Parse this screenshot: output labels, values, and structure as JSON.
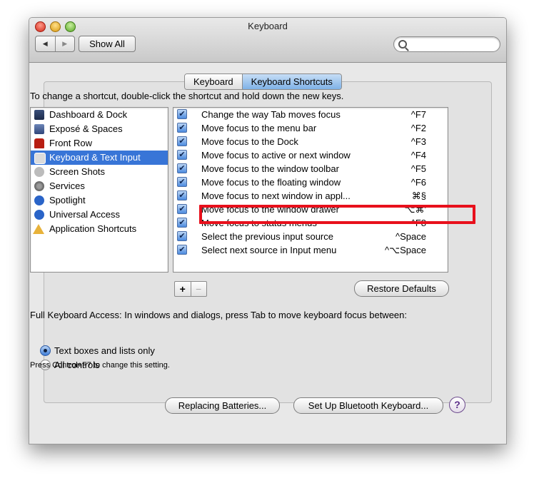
{
  "window": {
    "title": "Keyboard",
    "show_all_label": "Show All",
    "search_placeholder": ""
  },
  "tabs": [
    {
      "label": "Keyboard",
      "active": false
    },
    {
      "label": "Keyboard Shortcuts",
      "active": true
    }
  ],
  "instructions": "To change a shortcut, double-click the shortcut and hold down the new keys.",
  "sidebar": {
    "items": [
      {
        "label": "Dashboard & Dock",
        "icon": "dashboard-icon"
      },
      {
        "label": "Exposé & Spaces",
        "icon": "expose-icon"
      },
      {
        "label": "Front Row",
        "icon": "front-row-icon"
      },
      {
        "label": "Keyboard & Text Input",
        "icon": "keyboard-icon",
        "selected": true
      },
      {
        "label": "Screen Shots",
        "icon": "screenshot-icon"
      },
      {
        "label": "Services",
        "icon": "services-icon"
      },
      {
        "label": "Spotlight",
        "icon": "spotlight-icon"
      },
      {
        "label": "Universal Access",
        "icon": "universal-access-icon"
      },
      {
        "label": "Application Shortcuts",
        "icon": "app-shortcuts-icon"
      }
    ]
  },
  "shortcuts": {
    "rows": [
      {
        "label": "Change the way Tab moves focus",
        "key": "^F7",
        "checked": true
      },
      {
        "label": "Move focus to the menu bar",
        "key": "^F2",
        "checked": true
      },
      {
        "label": "Move focus to the Dock",
        "key": "^F3",
        "checked": true
      },
      {
        "label": "Move focus to active or next window",
        "key": "^F4",
        "checked": true
      },
      {
        "label": "Move focus to the window toolbar",
        "key": "^F5",
        "checked": true
      },
      {
        "label": "Move focus to the floating window",
        "key": "^F6",
        "checked": true
      },
      {
        "label": "Move focus to next window in appl...",
        "key": "⌘§",
        "checked": true
      },
      {
        "label": "Move focus to the window drawer",
        "key": "⌥⌘'",
        "checked": true
      },
      {
        "label": "Move focus to status menus",
        "key": "^F8",
        "checked": true
      },
      {
        "label": "Select the previous input source",
        "key": "^Space",
        "checked": true
      },
      {
        "label": "Select next source in Input menu",
        "key": "^⌥Space",
        "checked": true
      }
    ]
  },
  "controls": {
    "plus": "+",
    "minus": "−",
    "restore_defaults": "Restore Defaults"
  },
  "full_keyboard_access": {
    "label": "Full Keyboard Access: In windows and dialogs, press Tab to move keyboard focus between:",
    "options": [
      {
        "label": "Text boxes and lists only",
        "selected": true
      },
      {
        "label": "All controls",
        "selected": false
      }
    ],
    "note": "Press Control+F7 to change this setting."
  },
  "footer": {
    "replacing_batteries": "Replacing Batteries...",
    "setup_bluetooth": "Set Up Bluetooth Keyboard...",
    "help": "?"
  },
  "colors": {
    "selection": "#3875d7",
    "highlight_box": "#e8101c"
  }
}
